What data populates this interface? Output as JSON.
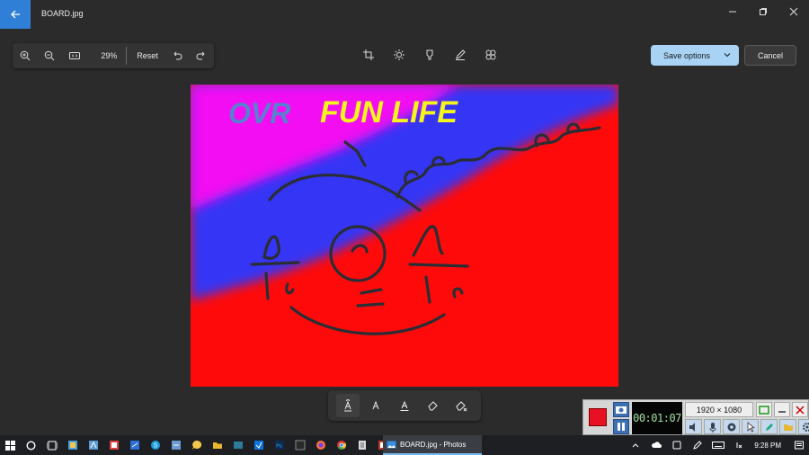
{
  "window": {
    "title": "BOARD.jpg"
  },
  "zoom": {
    "percent": "29%",
    "reset_label": "Reset"
  },
  "actions": {
    "save_label": "Save options",
    "cancel_label": "Cancel"
  },
  "canvas_text": {
    "left": "OVR",
    "right": "FUN LIFE"
  },
  "recorder": {
    "timer": "00:01:07",
    "resolution": "1920 × 1080"
  },
  "taskbar": {
    "active_app": "BOARD.jpg - Photos",
    "time": "9:28 PM"
  },
  "colors": {
    "accent": "#2f7fd6",
    "save_bg": "#a8d3f4",
    "canvas_red": "#ff0a0a",
    "canvas_blue": "#3535f5",
    "canvas_magenta": "#f20df2",
    "ovr": "#5a7fd0",
    "fun_life": "#f5f51e"
  }
}
